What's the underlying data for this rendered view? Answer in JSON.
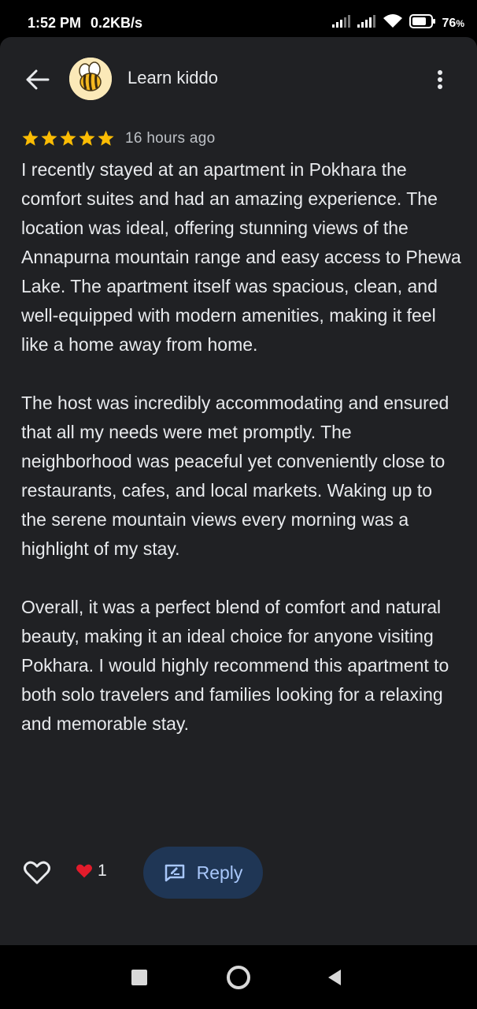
{
  "status_bar": {
    "time": "1:52 PM",
    "network_speed": "0.2KB/s",
    "battery_percent": "76",
    "battery_unit": "%",
    "icons": [
      "signal-icon",
      "signal-icon",
      "wifi-icon",
      "battery-icon"
    ]
  },
  "header": {
    "title": "Learn kiddo",
    "back_icon": "arrow-back-icon",
    "more_icon": "more-vert-icon",
    "avatar": "bee-avatar"
  },
  "review": {
    "rating": 5,
    "rating_max": 5,
    "star_color": "#fbbc04",
    "time_ago": "16 hours ago",
    "paragraphs": [
      "I recently stayed at an apartment in Pokhara the comfort suites and had an amazing experience. The location was ideal, offering stunning views of the Annapurna mountain range and easy access to Phewa Lake. The apartment itself was spacious, clean, and well-equipped with modern amenities, making it feel like a home away from home.",
      "The host was incredibly accommodating and ensured that all my needs were met promptly. The neighborhood was peaceful yet conveniently close to restaurants, cafes, and local markets. Waking up to the serene mountain views every morning was a highlight of my stay.",
      "Overall, it was a perfect blend of comfort and natural beauty, making it an ideal choice for anyone visiting Pokhara. I would highly recommend this apartment to both solo travelers and families looking for a relaxing and memorable stay."
    ]
  },
  "actions": {
    "like_icon": "heart-outline-icon",
    "like_count_icon": "heart-filled-icon",
    "like_count": "1",
    "reply_label": "Reply",
    "reply_icon": "reply-edit-icon",
    "accent": "#a8c7fa",
    "reply_bg": "#1f3655",
    "heart_color": "#e21b2b"
  },
  "nav_bar": {
    "recents_icon": "square-icon",
    "home_icon": "circle-home-icon",
    "back_icon": "triangle-back-icon"
  }
}
